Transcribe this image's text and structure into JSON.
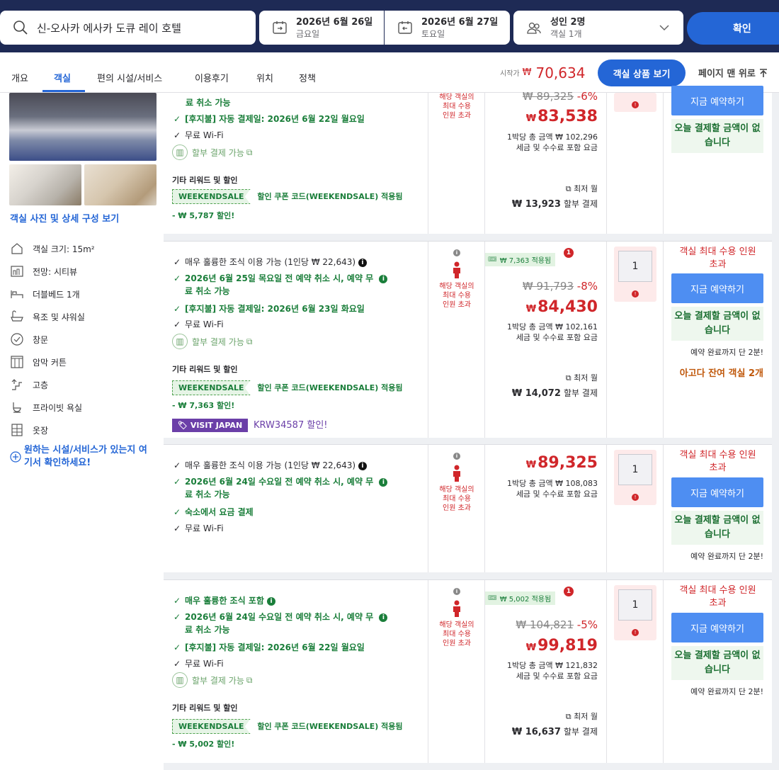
{
  "search": {
    "hotel": "신-오사카 에사카 도큐 레이 호텔",
    "checkin_date": "2026년 6월 26일",
    "checkin_day": "금요일",
    "checkout_date": "2026년 6월 27일",
    "checkout_day": "토요일",
    "guests": "성인 2명",
    "rooms": "객실 1개",
    "confirm": "확인"
  },
  "tabs": [
    "개요",
    "객실",
    "편의 시설/서비스",
    "이용후기",
    "위치",
    "정책"
  ],
  "nav": {
    "from_label": "시작가",
    "from_currency": "₩",
    "from_price": "70,634",
    "view_button": "객실 상품 보기",
    "top_button": "페이지 맨 위로"
  },
  "room": {
    "photo_link": "객실 사진 및 상세 구성 보기",
    "features": [
      {
        "icon": "room-size-icon",
        "label": "객실 크기: 15m²"
      },
      {
        "icon": "city-view-icon",
        "label": "전망: 시티뷰"
      },
      {
        "icon": "bed-icon",
        "label": "더블베드 1개"
      },
      {
        "icon": "bath-icon",
        "label": "욕조 및 샤워실"
      },
      {
        "icon": "window-icon",
        "label": "창문"
      },
      {
        "icon": "curtain-icon",
        "label": "암막 커튼"
      },
      {
        "icon": "high-floor-icon",
        "label": "고층"
      },
      {
        "icon": "private-bath-icon",
        "label": "프라이빗 욕실"
      },
      {
        "icon": "closet-icon",
        "label": "옷장"
      }
    ],
    "facility_link": "원하는 시설/서비스가 있는지 여기서 확인하세요!"
  },
  "common": {
    "capacity_note": "해당 객실의 최대 수용 인원 초과",
    "over_capacity": "객실 최대 수용 인원 초과",
    "book_now": "지금 예약하기",
    "no_payment": "오늘 결제할 금액이 없습니다",
    "two_min": "예약 완료까지 단 2분!",
    "installment": "할부 결제 가능",
    "rewards_header": "기타 리워드 및 할인",
    "coupon_code": "WEEKENDSALE",
    "coupon_text": "할인 쿠폰 코드(WEEKENDSALE) 적용됨",
    "min_month": "최저 월",
    "monthly_suffix": "할부 결제",
    "tax_note": "세금 및 수수료 포함 요금",
    "qty": "1",
    "alert": "!"
  },
  "row0": {
    "line1": "료 취소 가능",
    "line2": "[후지불] 자동 결제일: 2026년 6월 22일 월요일",
    "line3": "무료 Wi-Fi",
    "discount": "- ₩ 5,787 할인!",
    "orig": "₩ 89,325",
    "pct": "-6%",
    "price": "83,538",
    "per_night": "1박당 총 금액 ₩ 102,296",
    "monthly": "₩ 13,923"
  },
  "row1": {
    "line1": "매우 훌륭한 조식 이용 가능 (1인당 ₩ 22,643)",
    "line2a": "2026년 6월 25일 목요일 전 예약 취소 시, 예약 무",
    "line2b": "료 취소 가능",
    "line3": "[후지불] 자동 결제일: 2026년 6월 23일 화요일",
    "line4": "무료 Wi-Fi",
    "discount": "- ₩ 7,363 할인!",
    "visit_japan": "VISIT JAPAN",
    "visit_discount": "KRW34587 할인!",
    "applied": "₩ 7,363 적용됨",
    "badge": "1",
    "orig": "₩ 91,793",
    "pct": "-8%",
    "price": "84,430",
    "per_night": "1박당 총 금액 ₩ 102,161",
    "monthly": "₩ 14,072",
    "rooms_left": "아고다 잔여 객실 2개"
  },
  "row2": {
    "line1": "매우 훌륭한 조식 이용 가능 (1인당 ₩ 22,643)",
    "line2a": "2026년 6월 24일 수요일 전 예약 취소 시, 예약 무",
    "line2b": "료 취소 가능",
    "line3": "숙소에서 요금 결제",
    "line4": "무료 Wi-Fi",
    "price": "89,325",
    "per_night": "1박당 총 금액 ₩ 108,083"
  },
  "row3": {
    "line1": "매우 훌륭한 조식 포함",
    "line2a": "2026년 6월 24일 수요일 전 예약 취소 시, 예약 무",
    "line2b": "료 취소 가능",
    "line3": "[후지불] 자동 결제일: 2026년 6월 22일 월요일",
    "line4": "무료 Wi-Fi",
    "discount": "- ₩ 5,002 할인!",
    "applied": "₩ 5,002 적용됨",
    "badge": "1",
    "orig": "₩ 104,821",
    "pct": "-5%",
    "price": "99,819",
    "per_night": "1박당 총 금액 ₩ 121,832",
    "monthly": "₩ 16,637"
  },
  "colors": {
    "navy": "#1e2a55",
    "primary": "#2466d6",
    "red": "#d0262a",
    "green": "#1a7e3a",
    "purple": "#6b3fa8"
  }
}
